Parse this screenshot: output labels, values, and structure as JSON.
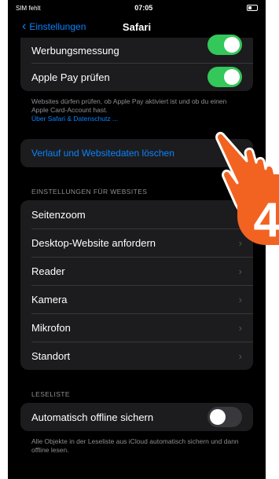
{
  "status_bar": {
    "carrier": "SIM fehlt",
    "time": "07:05"
  },
  "nav": {
    "back_label": "Einstellungen",
    "title": "Safari"
  },
  "privacy_group": {
    "items": [
      {
        "label": "Werbungsmessung",
        "toggle": "on"
      },
      {
        "label": "Apple Pay prüfen",
        "toggle": "on"
      }
    ]
  },
  "privacy_footer": {
    "text": "Websites dürfen prüfen, ob Apple Pay aktiviert ist und ob du einen Apple Card-Account hast.",
    "link": "Über Safari & Datenschutz ..."
  },
  "clear_history": {
    "label": "Verlauf und Websitedaten löschen"
  },
  "website_settings": {
    "header": "EINSTELLUNGEN FÜR WEBSITES",
    "items": [
      {
        "label": "Seitenzoom"
      },
      {
        "label": "Desktop-Website anfordern"
      },
      {
        "label": "Reader"
      },
      {
        "label": "Kamera"
      },
      {
        "label": "Mikrofon"
      },
      {
        "label": "Standort"
      }
    ]
  },
  "reading_list": {
    "header": "LESELISTE",
    "item": {
      "label": "Automatisch offline sichern",
      "toggle": "off"
    },
    "footer": "Alle Objekte in der Leseliste aus iCloud automatisch sichern und dann offline lesen."
  },
  "annotation": {
    "step_number": "4"
  },
  "colors": {
    "accent": "#0a84ff",
    "toggle_on": "#34c759",
    "annotation": "#f26322"
  }
}
